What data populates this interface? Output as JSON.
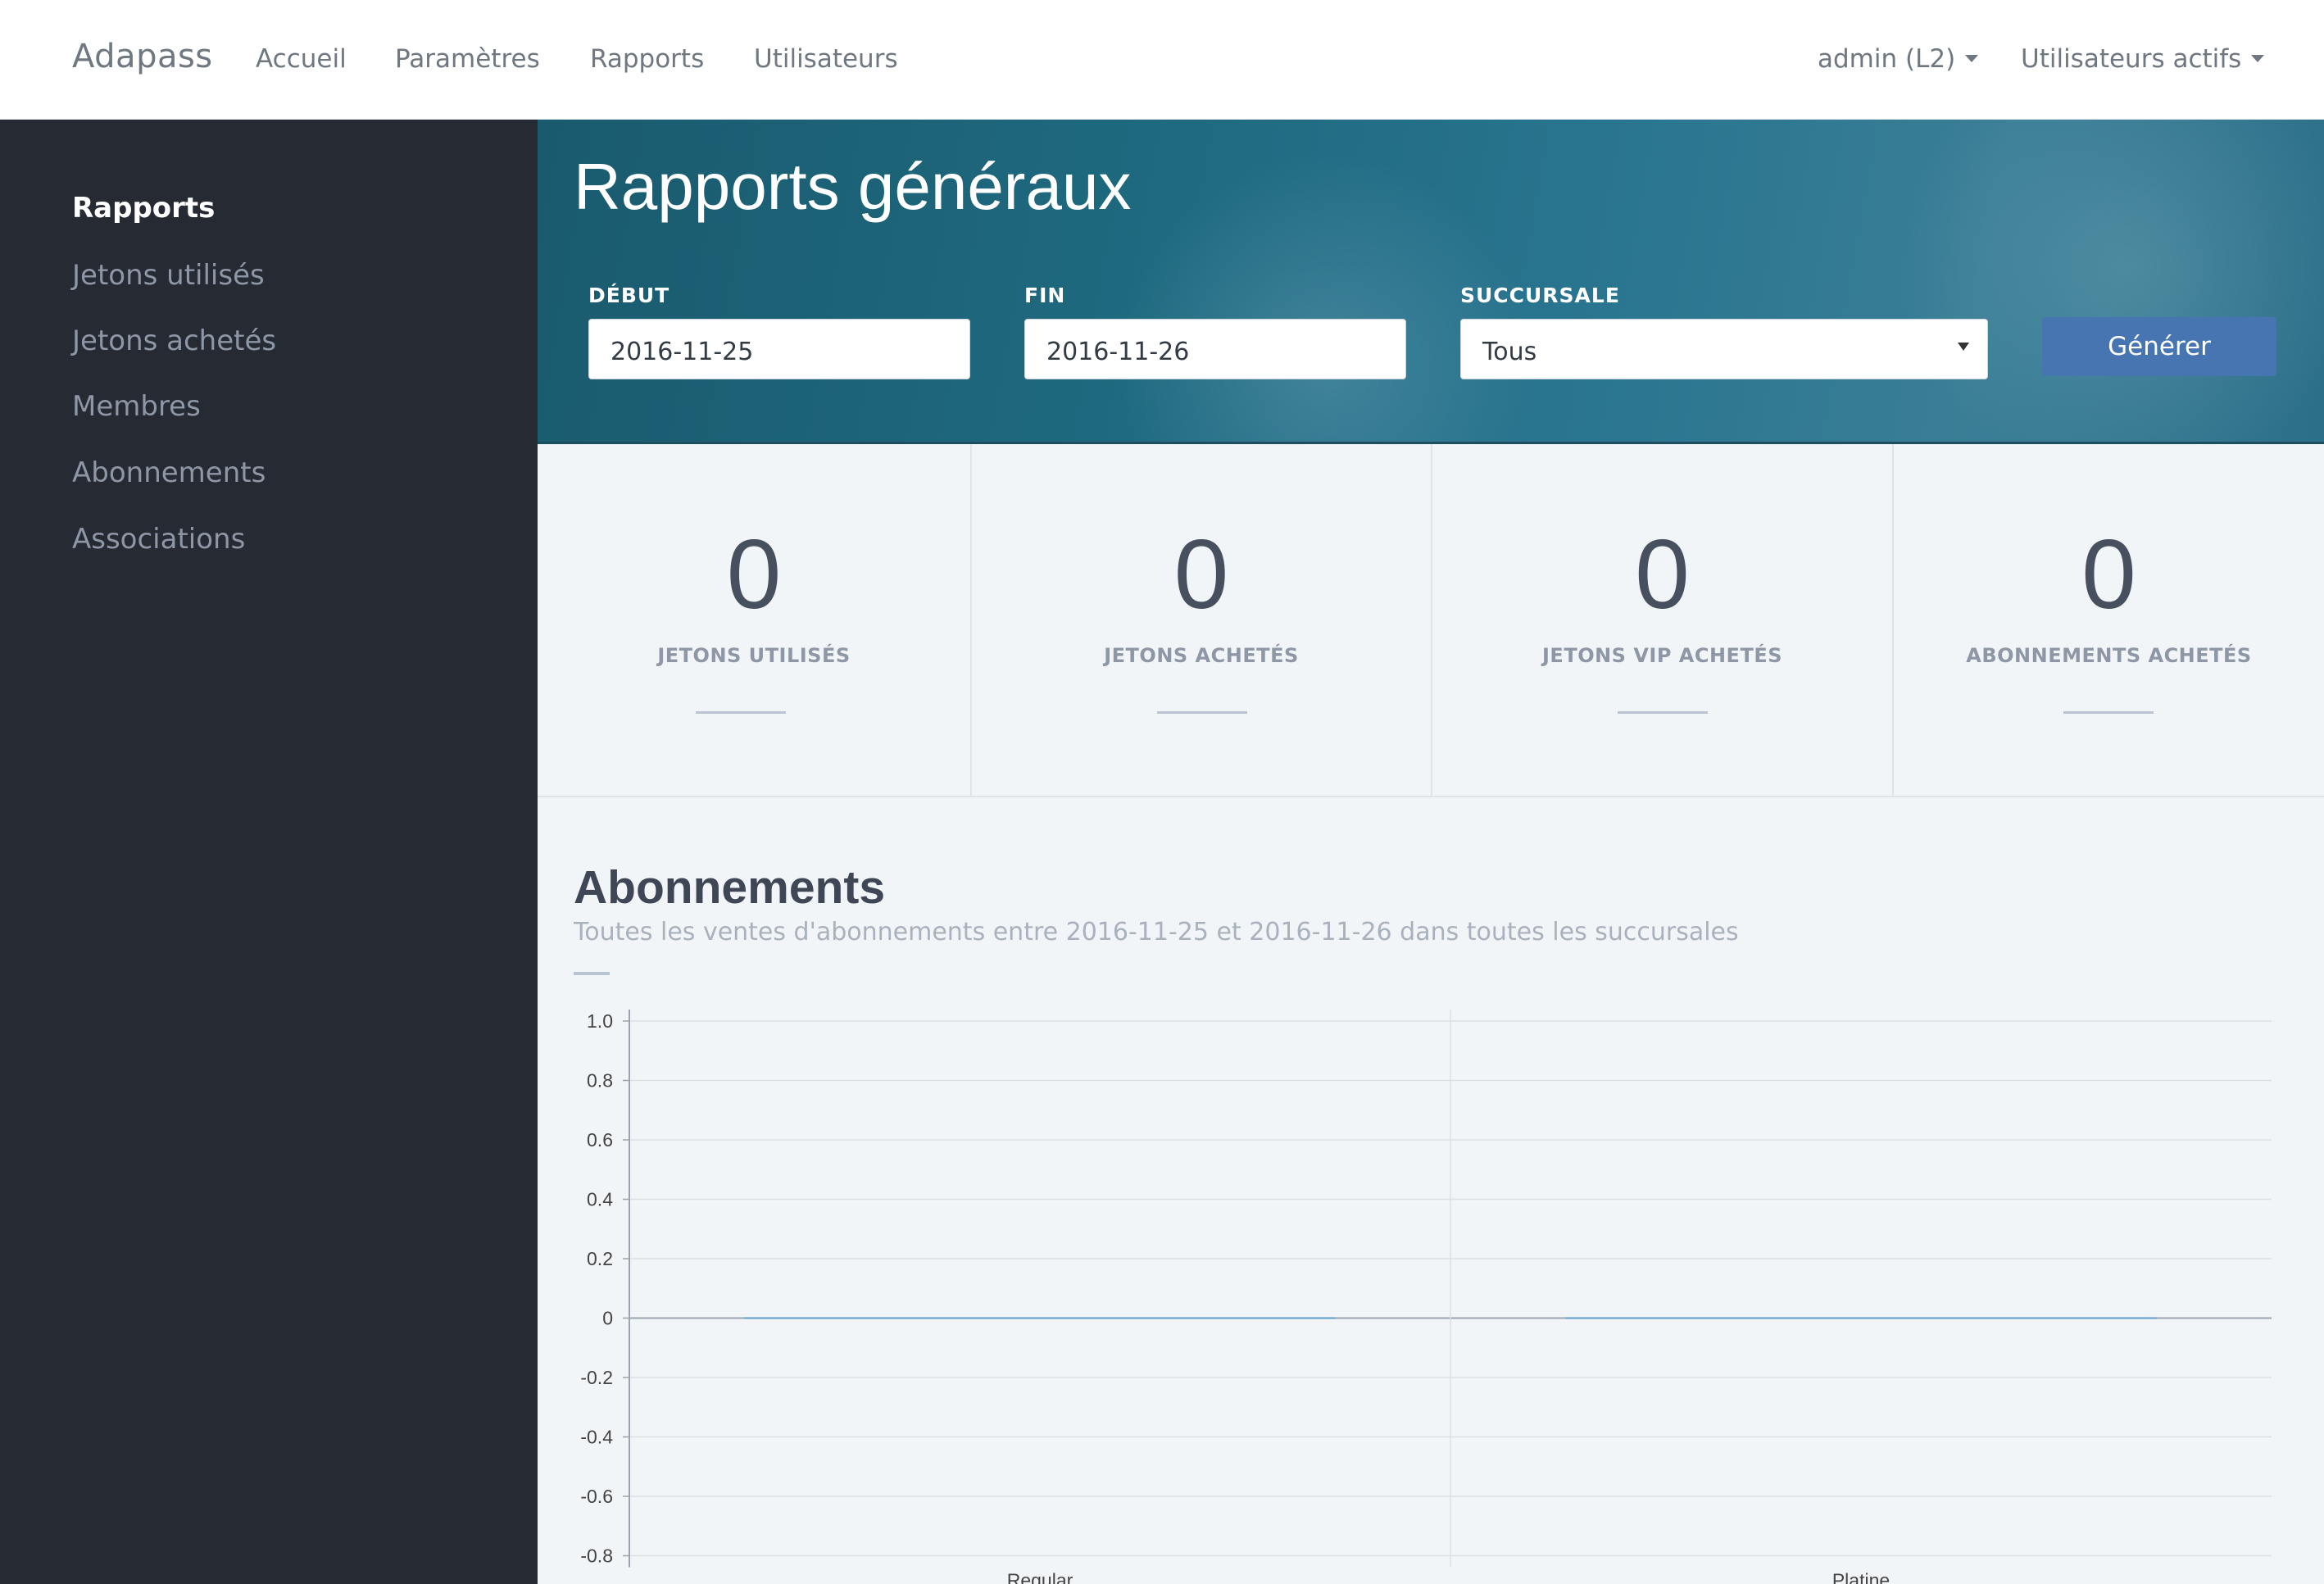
{
  "navbar": {
    "brand": "Adapass",
    "items": [
      "Accueil",
      "Paramètres",
      "Rapports",
      "Utilisateurs"
    ],
    "user_menu": "admin (L2)",
    "active_users_menu": "Utilisateurs actifs"
  },
  "sidebar": {
    "items": [
      "Rapports",
      "Jetons utilisés",
      "Jetons achetés",
      "Membres",
      "Abonnements",
      "Associations"
    ],
    "active": "Rapports"
  },
  "hero": {
    "title": "Rapports généraux",
    "start_label": "DÉBUT",
    "start_value": "2016-11-25",
    "end_label": "FIN",
    "end_value": "2016-11-26",
    "branch_label": "SUCCURSALE",
    "branch_value": "Tous",
    "generate_button": "Générer"
  },
  "stats": [
    {
      "value": "0",
      "label": "JETONS UTILISÉS"
    },
    {
      "value": "0",
      "label": "JETONS ACHETÉS"
    },
    {
      "value": "0",
      "label": "JETONS VIP ACHETÉS"
    },
    {
      "value": "0",
      "label": "ABONNEMENTS ACHETÉS"
    }
  ],
  "section": {
    "title": "Abonnements",
    "subtitle": "Toutes les ventes d'abonnements entre 2016-11-25 et 2016-11-26 dans toutes les succursales"
  },
  "chart_data": {
    "type": "bar",
    "categories": [
      "Regular",
      "Platine"
    ],
    "values": [
      0,
      0
    ],
    "ylim": [
      -0.8,
      1.0
    ],
    "yticks": [
      "1.0",
      "0.8",
      "0.6",
      "0.4",
      "0.2",
      "0",
      "-0.2",
      "-0.4",
      "-0.6",
      "-0.8"
    ],
    "grid": true,
    "colors": {
      "bar": "#5b9bc8",
      "grid": "#dcdfe4",
      "axis": "#9aa3ae"
    }
  }
}
